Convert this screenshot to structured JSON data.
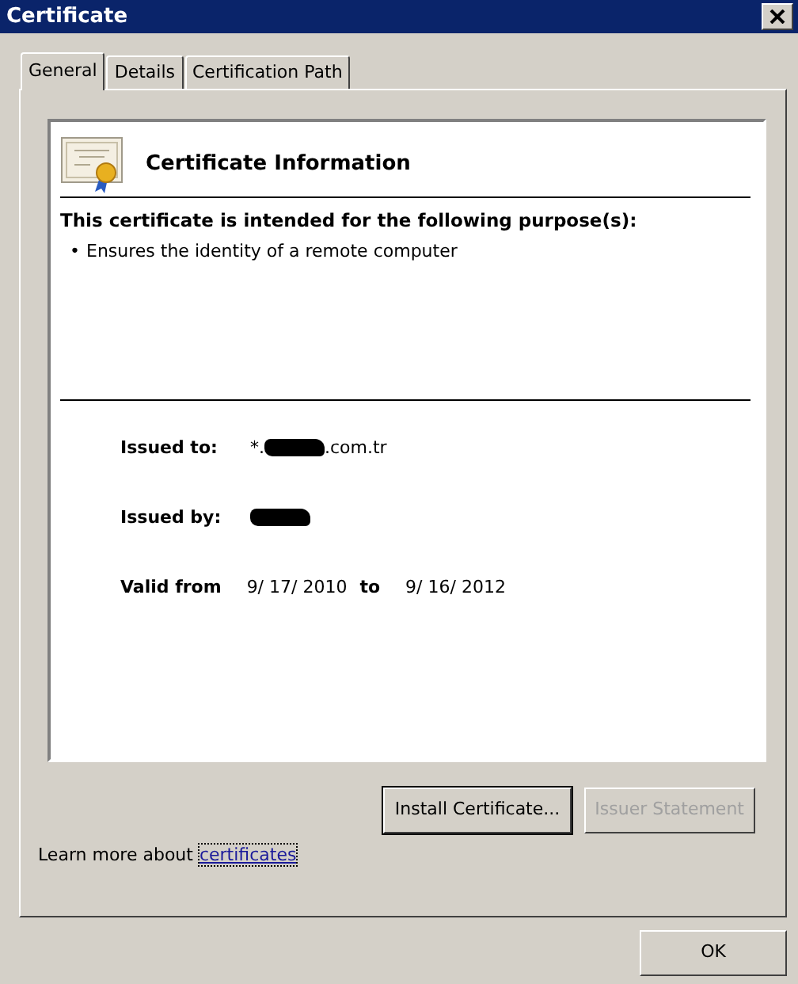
{
  "window": {
    "title": "Certificate"
  },
  "tabs": [
    {
      "label": "General",
      "selected": true
    },
    {
      "label": "Details",
      "selected": false
    },
    {
      "label": "Certification Path",
      "selected": false
    }
  ],
  "info": {
    "heading": "Certificate Information",
    "purpose_heading": "This certificate is intended for the following purpose(s):",
    "purposes": [
      {
        "bullet": "•",
        "text": "Ensures the identity of a remote computer"
      }
    ],
    "fields": [
      {
        "label": "Issued to:",
        "parts": [
          {
            "kind": "text",
            "text": "*."
          },
          {
            "kind": "redacted"
          },
          {
            "kind": "text",
            "text": ".com.tr"
          }
        ]
      },
      {
        "label": "Issued by:",
        "parts": [
          {
            "kind": "redacted"
          }
        ]
      }
    ],
    "validity": {
      "from_label": "Valid from",
      "from": "9/ 17/ 2010",
      "to_label": "to",
      "to": "9/ 16/ 2012"
    }
  },
  "buttons": [
    {
      "label": "Install Certificate...",
      "disabled": false,
      "focused": true
    },
    {
      "label": "Issuer Statement",
      "disabled": true,
      "focused": false
    }
  ],
  "learn_more": {
    "text": "Learn more about",
    "link": "certificates",
    "link_focused": true
  },
  "footer_buttons": [
    {
      "label": "OK",
      "disabled": false
    }
  ]
}
